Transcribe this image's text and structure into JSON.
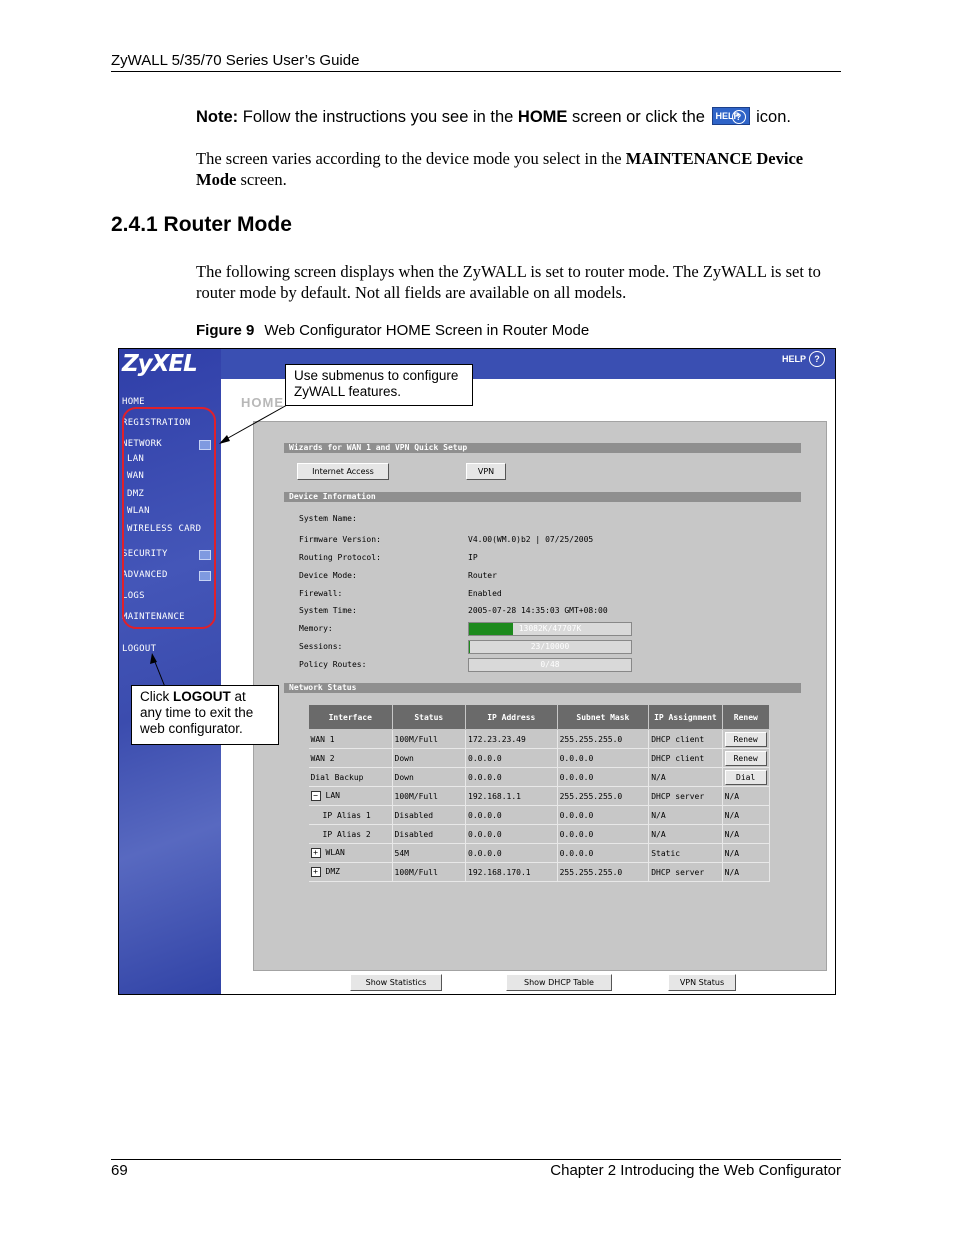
{
  "header": {
    "title": "ZyWALL 5/35/70 Series User’s Guide"
  },
  "note": {
    "label": "Note:",
    "text_before": " Follow the instructions you see in the ",
    "home": "HOME",
    "text_middle": " screen or click the ",
    "icon_text": "HELP",
    "text_after": " icon."
  },
  "para1": {
    "text1": "The screen varies according to the device mode you select in the ",
    "bold": "MAINTENANCE Device Mode",
    "text2": " screen."
  },
  "section": {
    "title": "2.4.1  Router Mode"
  },
  "para2": {
    "text": "The following screen displays when the ZyWALL is set to router mode. The ZyWALL is set to router mode by default. Not all fields are available on all models."
  },
  "figure": {
    "label": "Figure 9",
    "caption": "Web Configurator HOME Screen in Router Mode"
  },
  "screenshot": {
    "logo": "ZyXEL",
    "help_label": "HELP",
    "help_q": "?",
    "page_title": "HOME",
    "nav": {
      "home": "HOME",
      "registration": "REGISTRATION",
      "network": "NETWORK",
      "lan": "LAN",
      "wan": "WAN",
      "dmz": "DMZ",
      "wlan": "WLAN",
      "wireless_card": "WIRELESS CARD",
      "security": "SECURITY",
      "advanced": "ADVANCED",
      "logs": "LOGS",
      "maintenance": "MAINTENANCE",
      "logout": "LOGOUT"
    },
    "wizards": {
      "title": "Wizards for WAN 1 and VPN Quick Setup",
      "internet_access": "Internet Access",
      "vpn": "VPN"
    },
    "device_info": {
      "title": "Device Information",
      "labels": {
        "system_name": "System Name:",
        "firmware": "Firmware Version:",
        "routing": "Routing Protocol:",
        "mode": "Device Mode:",
        "firewall": "Firewall:",
        "time": "System Time:",
        "memory": "Memory:",
        "sessions": "Sessions:",
        "policy": "Policy Routes:"
      },
      "values": {
        "firmware": "V4.00(WM.0)b2 | 07/25/2005",
        "routing": "IP",
        "mode": "Router",
        "firewall": "Enabled",
        "time": "2005-07-28   14:35:03    GMT+08:00",
        "memory": "13082K/47707K",
        "sessions": "23/10000",
        "policy": "0/48"
      },
      "memory_fraction": 0.274,
      "sessions_fraction": 0.0023,
      "policy_fraction": 0.0
    },
    "network_status": {
      "title": "Network Status",
      "columns": [
        "Interface",
        "Status",
        "IP Address",
        "Subnet Mask",
        "IP Assignment",
        "Renew"
      ],
      "rows": [
        {
          "iface": "WAN 1",
          "status": "100M/Full",
          "ip": "172.23.23.49",
          "mask": "255.255.255.0",
          "assign": "DHCP client",
          "renew": "Renew"
        },
        {
          "iface": "WAN 2",
          "status": "Down",
          "ip": "0.0.0.0",
          "mask": "0.0.0.0",
          "assign": "DHCP client",
          "renew": "Renew"
        },
        {
          "iface": "Dial Backup",
          "status": "Down",
          "ip": "0.0.0.0",
          "mask": "0.0.0.0",
          "assign": "N/A",
          "renew": "Dial"
        },
        {
          "iface": "LAN",
          "status": "100M/Full",
          "ip": "192.168.1.1",
          "mask": "255.255.255.0",
          "assign": "DHCP server",
          "renew": "N/A"
        },
        {
          "iface": "IP Alias 1",
          "status": "Disabled",
          "ip": "0.0.0.0",
          "mask": "0.0.0.0",
          "assign": "N/A",
          "renew": "N/A"
        },
        {
          "iface": "IP Alias 2",
          "status": "Disabled",
          "ip": "0.0.0.0",
          "mask": "0.0.0.0",
          "assign": "N/A",
          "renew": "N/A"
        },
        {
          "iface": "WLAN",
          "status": "54M",
          "ip": "0.0.0.0",
          "mask": "0.0.0.0",
          "assign": "Static",
          "renew": "N/A"
        },
        {
          "iface": "DMZ",
          "status": "100M/Full",
          "ip": "192.168.170.1",
          "mask": "255.255.255.0",
          "assign": "DHCP server",
          "renew": "N/A"
        }
      ],
      "minus": "−",
      "plus": "+",
      "show_statistics": "Show Statistics",
      "show_dhcp": "Show DHCP Table",
      "vpn_status": "VPN Status"
    }
  },
  "callouts": {
    "submenus": "Use submenus to configure ZyWALL features.",
    "logout_pre": "Click ",
    "logout_bold": "LOGOUT",
    "logout_post": " at any time to exit the web configurator."
  },
  "footer": {
    "page": "69",
    "chapter": "Chapter 2 Introducing the Web Configurator"
  }
}
